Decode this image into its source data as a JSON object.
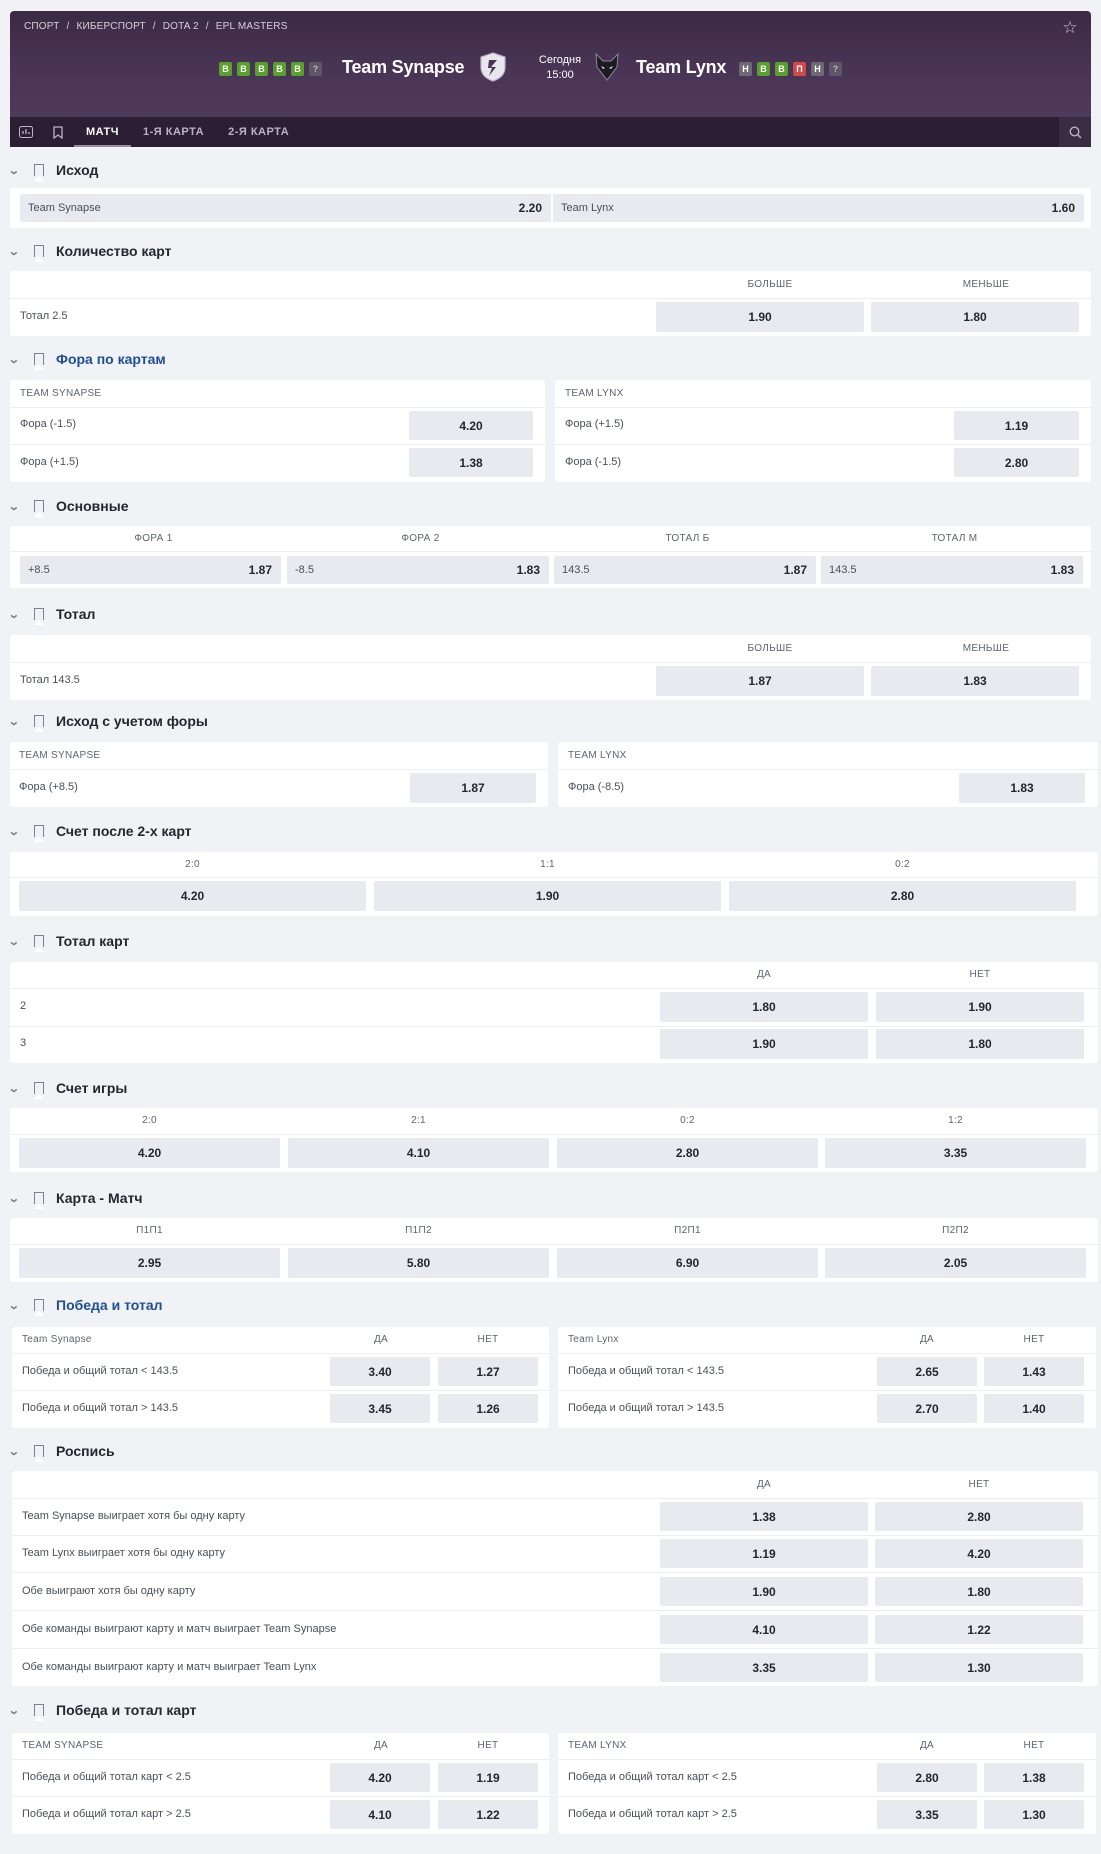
{
  "header": {
    "breadcrumbs": [
      "СПОРТ",
      "/",
      "КИБЕРСПОРТ",
      "/",
      "DOTA 2",
      "/",
      "EPL MASTERS"
    ],
    "team1": {
      "name": "Team Synapse",
      "form": [
        "В",
        "В",
        "В",
        "В",
        "В",
        "?"
      ]
    },
    "team2": {
      "name": "Team Lynx",
      "form": [
        "Н",
        "В",
        "В",
        "П",
        "Н",
        "?"
      ]
    },
    "date": "Сегодня",
    "time": "15:00",
    "tabs": [
      "МАТЧ",
      "1-Я КАРТА",
      "2-Я КАРТА"
    ]
  },
  "sections": {
    "outcome": {
      "title": "Исход",
      "items": [
        {
          "label": "Team Synapse",
          "odd": "2.20"
        },
        {
          "label": "Team Lynx",
          "odd": "1.60"
        }
      ]
    },
    "maps_count": {
      "title": "Количество карт",
      "col1": "БОЛЬШЕ",
      "col2": "МЕНЬШЕ",
      "row": "Тотал 2.5",
      "v1": "1.90",
      "v2": "1.80"
    },
    "map_handicap": {
      "title": "Фора по картам",
      "left_head": "TEAM SYNAPSE",
      "right_head": "TEAM LYNX",
      "left": [
        {
          "label": "Фора (-1.5)",
          "odd": "4.20"
        },
        {
          "label": "Фора (+1.5)",
          "odd": "1.38"
        }
      ],
      "right": [
        {
          "label": "Фора (+1.5)",
          "odd": "1.19"
        },
        {
          "label": "Фора (-1.5)",
          "odd": "2.80"
        }
      ]
    },
    "main": {
      "title": "Основные",
      "heads": [
        "ФОРА 1",
        "ФОРА 2",
        "ТОТАЛ Б",
        "ТОТАЛ М"
      ],
      "items": [
        {
          "label": "+8.5",
          "odd": "1.87"
        },
        {
          "label": "-8.5",
          "odd": "1.83"
        },
        {
          "label": "143.5",
          "odd": "1.87"
        },
        {
          "label": "143.5",
          "odd": "1.83"
        }
      ]
    },
    "total": {
      "title": "Тотал",
      "col1": "БОЛЬШЕ",
      "col2": "МЕНЬШЕ",
      "row": "Тотал 143.5",
      "v1": "1.87",
      "v2": "1.83"
    },
    "handicap_outcome": {
      "title": "Исход с учетом форы",
      "left_head": "TEAM SYNAPSE",
      "right_head": "TEAM LYNX",
      "left": {
        "label": "Фора (+8.5)",
        "odd": "1.87"
      },
      "right": {
        "label": "Фора (-8.5)",
        "odd": "1.83"
      }
    },
    "score_after2": {
      "title": "Счет после 2-х карт",
      "heads": [
        "2:0",
        "1:1",
        "0:2"
      ],
      "odds": [
        "4.20",
        "1.90",
        "2.80"
      ]
    },
    "total_maps": {
      "title": "Тотал карт",
      "col1": "ДА",
      "col2": "НЕТ",
      "rows": [
        {
          "label": "2",
          "v1": "1.80",
          "v2": "1.90"
        },
        {
          "label": "3",
          "v1": "1.90",
          "v2": "1.80"
        }
      ]
    },
    "game_score": {
      "title": "Счет игры",
      "heads": [
        "2:0",
        "2:1",
        "0:2",
        "1:2"
      ],
      "odds": [
        "4.20",
        "4.10",
        "2.80",
        "3.35"
      ]
    },
    "map_match": {
      "title": "Карта - Матч",
      "heads": [
        "П1П1",
        "П1П2",
        "П2П1",
        "П2П2"
      ],
      "odds": [
        "2.95",
        "5.80",
        "6.90",
        "2.05"
      ]
    },
    "win_total": {
      "title": "Победа и тотал",
      "left_head": "Team Synapse",
      "right_head": "Team Lynx",
      "col1": "ДА",
      "col2": "НЕТ",
      "left": [
        {
          "label": "Победа и общий тотал < 143.5",
          "v1": "3.40",
          "v2": "1.27"
        },
        {
          "label": "Победа и общий тотал > 143.5",
          "v1": "3.45",
          "v2": "1.26"
        }
      ],
      "right": [
        {
          "label": "Победа и общий тотал < 143.5",
          "v1": "2.65",
          "v2": "1.43"
        },
        {
          "label": "Победа и общий тотал > 143.5",
          "v1": "2.70",
          "v2": "1.40"
        }
      ]
    },
    "schedule": {
      "title": "Роспись",
      "col1": "ДА",
      "col2": "НЕТ",
      "rows": [
        {
          "label": "Team Synapse выиграет хотя бы одну карту",
          "v1": "1.38",
          "v2": "2.80"
        },
        {
          "label": "Team Lynx выиграет хотя бы одну карту",
          "v1": "1.19",
          "v2": "4.20"
        },
        {
          "label": "Обе выиграют хотя бы одну карту",
          "v1": "1.90",
          "v2": "1.80"
        },
        {
          "label": "Обе команды выиграют карту и матч выиграет Team Synapse",
          "v1": "4.10",
          "v2": "1.22"
        },
        {
          "label": "Обе команды выиграют карту и матч выиграет Team Lynx",
          "v1": "3.35",
          "v2": "1.30"
        }
      ]
    },
    "win_total_maps": {
      "title": "Победа и тотал карт",
      "left_head": "TEAM SYNAPSE",
      "right_head": "TEAM LYNX",
      "col1": "ДА",
      "col2": "НЕТ",
      "left": [
        {
          "label": "Победа и общий тотал карт < 2.5",
          "v1": "4.20",
          "v2": "1.19"
        },
        {
          "label": "Победа и общий тотал карт > 2.5",
          "v1": "4.10",
          "v2": "1.22"
        }
      ],
      "right": [
        {
          "label": "Победа и общий тотал карт < 2.5",
          "v1": "2.80",
          "v2": "1.38"
        },
        {
          "label": "Победа и общий тотал карт > 2.5",
          "v1": "3.35",
          "v2": "1.30"
        }
      ]
    }
  },
  "colors": {
    "header_bg": "#4a3556",
    "tabbar_bg": "#2c1f33",
    "win": "#5aa02c",
    "loss": "#d04a4a",
    "link": "#1d4f91"
  }
}
